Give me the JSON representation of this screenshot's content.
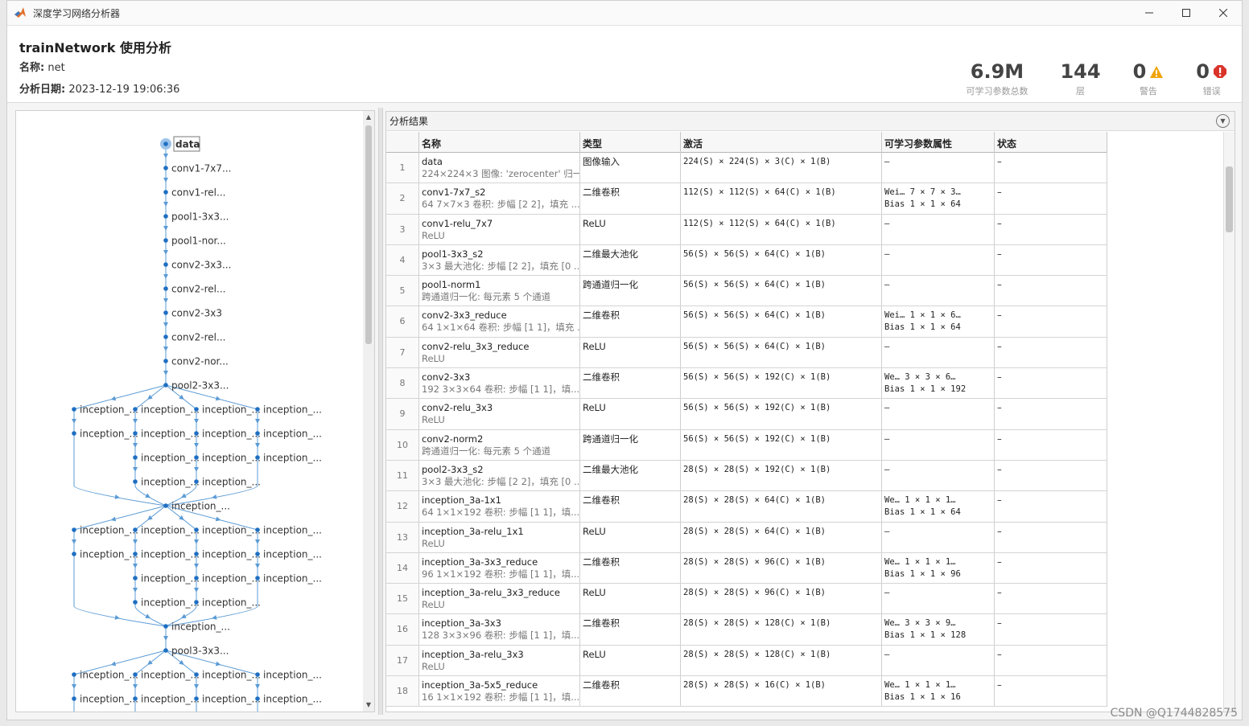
{
  "window": {
    "title": "深度学习网络分析器",
    "accent": "#5b9bd5"
  },
  "header": {
    "title": "trainNetwork 使用分析",
    "name_label": "名称:",
    "name_value": "net",
    "date_label": "分析日期:",
    "date_value": "2023-12-19 19:06:36"
  },
  "stats": {
    "params": {
      "value": "6.9M",
      "label": "可学习参数总数"
    },
    "layers": {
      "value": "144",
      "label": "层"
    },
    "warnings": {
      "value": "0",
      "label": "警告",
      "color": "#f0a30a"
    },
    "errors": {
      "value": "0",
      "label": "错误",
      "color": "#d9342b"
    }
  },
  "graph": {
    "nodes_main": [
      {
        "label": "data",
        "row": 0
      },
      {
        "label": "conv1-7x7...",
        "row": 1
      },
      {
        "label": "conv1-rel...",
        "row": 2
      },
      {
        "label": "pool1-3x3...",
        "row": 3
      },
      {
        "label": "pool1-nor...",
        "row": 4
      },
      {
        "label": "conv2-3x3...",
        "row": 5
      },
      {
        "label": "conv2-rel...",
        "row": 6
      },
      {
        "label": "conv2-3x3",
        "row": 7
      },
      {
        "label": "conv2-rel...",
        "row": 8
      },
      {
        "label": "conv2-nor...",
        "row": 9
      },
      {
        "label": "pool2-3x3...",
        "row": 10
      },
      {
        "label": "inception_...",
        "row": 15
      },
      {
        "label": "inception_...",
        "row": 20
      },
      {
        "label": "pool3-3x3...",
        "row": 21
      }
    ],
    "branch_label": "inception_..."
  },
  "results": {
    "title": "分析结果",
    "columns": [
      "",
      "名称",
      "类型",
      "激活",
      "可学习参数属性",
      "状态"
    ],
    "rows": [
      {
        "n": "1",
        "name": "data",
        "desc": "224×224×3 图像: 'zerocenter' 归一...",
        "type": "图像输入",
        "act": "224(S) × 224(S) × 3(C) × 1(B)",
        "p1": "–",
        "p2": "",
        "status": "–"
      },
      {
        "n": "2",
        "name": "conv1-7x7_s2",
        "desc": "64 7×7×3 卷积: 步幅 [2 2]，填充 ...",
        "type": "二维卷积",
        "act": "112(S) × 112(S) × 64(C) × 1(B)",
        "p1": "Wei…  7 × 7 × 3…",
        "p2": "Bias  1 × 1 × 64",
        "status": "–"
      },
      {
        "n": "3",
        "name": "conv1-relu_7x7",
        "desc": "ReLU",
        "type": "ReLU",
        "act": "112(S) × 112(S) × 64(C) × 1(B)",
        "p1": "–",
        "p2": "",
        "status": "–"
      },
      {
        "n": "4",
        "name": "pool1-3x3_s2",
        "desc": "3×3 最大池化: 步幅 [2 2]，填充 [0 ...",
        "type": "二维最大池化",
        "act": "56(S) × 56(S) × 64(C) × 1(B)",
        "p1": "–",
        "p2": "",
        "status": "–"
      },
      {
        "n": "5",
        "name": "pool1-norm1",
        "desc": "跨通道归一化: 每元素 5 个通道",
        "type": "跨通道归一化",
        "act": "56(S) × 56(S) × 64(C) × 1(B)",
        "p1": "–",
        "p2": "",
        "status": "–"
      },
      {
        "n": "6",
        "name": "conv2-3x3_reduce",
        "desc": "64 1×1×64 卷积: 步幅 [1 1]，填充 ...",
        "type": "二维卷积",
        "act": "56(S) × 56(S) × 64(C) × 1(B)",
        "p1": "Wei…  1 × 1 × 6…",
        "p2": "Bias  1 × 1 × 64",
        "status": "–"
      },
      {
        "n": "7",
        "name": "conv2-relu_3x3_reduce",
        "desc": "ReLU",
        "type": "ReLU",
        "act": "56(S) × 56(S) × 64(C) × 1(B)",
        "p1": "–",
        "p2": "",
        "status": "–"
      },
      {
        "n": "8",
        "name": "conv2-3x3",
        "desc": "192 3×3×64 卷积: 步幅 [1 1]，填...",
        "type": "二维卷积",
        "act": "56(S) × 56(S) × 192(C) × 1(B)",
        "p1": "We…  3 × 3 × 6…",
        "p2": "Bias  1 × 1 × 192",
        "status": "–"
      },
      {
        "n": "9",
        "name": "conv2-relu_3x3",
        "desc": "ReLU",
        "type": "ReLU",
        "act": "56(S) × 56(S) × 192(C) × 1(B)",
        "p1": "–",
        "p2": "",
        "status": "–"
      },
      {
        "n": "10",
        "name": "conv2-norm2",
        "desc": "跨通道归一化: 每元素 5 个通道",
        "type": "跨通道归一化",
        "act": "56(S) × 56(S) × 192(C) × 1(B)",
        "p1": "–",
        "p2": "",
        "status": "–"
      },
      {
        "n": "11",
        "name": "pool2-3x3_s2",
        "desc": "3×3 最大池化: 步幅 [2 2]，填充 [0 ...",
        "type": "二维最大池化",
        "act": "28(S) × 28(S) × 192(C) × 1(B)",
        "p1": "–",
        "p2": "",
        "status": "–"
      },
      {
        "n": "12",
        "name": "inception_3a-1x1",
        "desc": "64 1×1×192 卷积: 步幅 [1 1]，填...",
        "type": "二维卷积",
        "act": "28(S) × 28(S) × 64(C) × 1(B)",
        "p1": "We…  1 × 1 × 1…",
        "p2": "Bias  1 × 1 × 64",
        "status": "–"
      },
      {
        "n": "13",
        "name": "inception_3a-relu_1x1",
        "desc": "ReLU",
        "type": "ReLU",
        "act": "28(S) × 28(S) × 64(C) × 1(B)",
        "p1": "–",
        "p2": "",
        "status": "–"
      },
      {
        "n": "14",
        "name": "inception_3a-3x3_reduce",
        "desc": "96 1×1×192 卷积: 步幅 [1 1]，填...",
        "type": "二维卷积",
        "act": "28(S) × 28(S) × 96(C) × 1(B)",
        "p1": "We…  1 × 1 × 1…",
        "p2": "Bias  1 × 1 × 96",
        "status": "–"
      },
      {
        "n": "15",
        "name": "inception_3a-relu_3x3_reduce",
        "desc": "ReLU",
        "type": "ReLU",
        "act": "28(S) × 28(S) × 96(C) × 1(B)",
        "p1": "–",
        "p2": "",
        "status": "–"
      },
      {
        "n": "16",
        "name": "inception_3a-3x3",
        "desc": "128 3×3×96 卷积: 步幅 [1 1]，填...",
        "type": "二维卷积",
        "act": "28(S) × 28(S) × 128(C) × 1(B)",
        "p1": "We…  3 × 3 × 9…",
        "p2": "Bias  1 × 1 × 128",
        "status": "–"
      },
      {
        "n": "17",
        "name": "inception_3a-relu_3x3",
        "desc": "ReLU",
        "type": "ReLU",
        "act": "28(S) × 28(S) × 128(C) × 1(B)",
        "p1": "–",
        "p2": "",
        "status": "–"
      },
      {
        "n": "18",
        "name": "inception_3a-5x5_reduce",
        "desc": "16 1×1×192 卷积: 步幅 [1 1]，填...",
        "type": "二维卷积",
        "act": "28(S) × 28(S) × 16(C) × 1(B)",
        "p1": "We…  1 × 1 × 1…",
        "p2": "Bias  1 × 1 × 16",
        "status": "–"
      }
    ]
  },
  "watermark": "CSDN @Q1744828575"
}
